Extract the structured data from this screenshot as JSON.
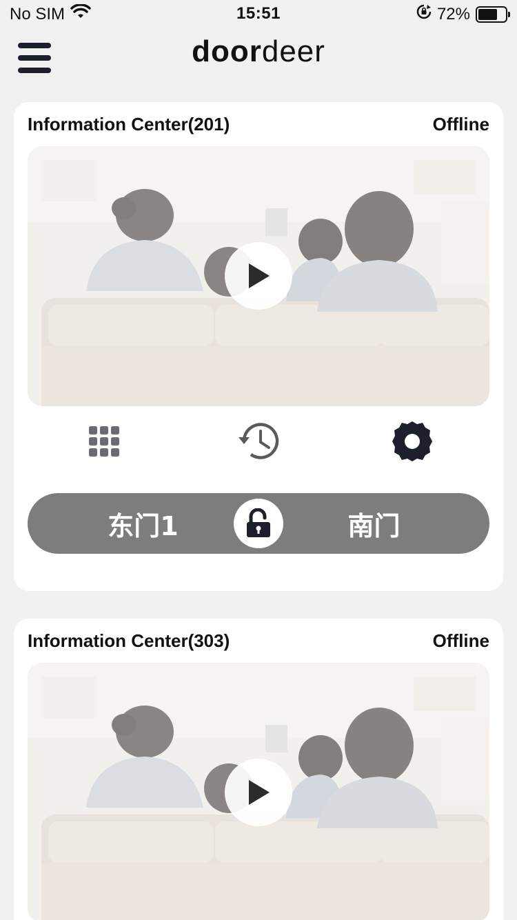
{
  "status_bar": {
    "carrier": "No SIM",
    "time": "15:51",
    "battery_text": "72%",
    "battery_level": 0.72,
    "icons": [
      "wifi-icon",
      "orientation-lock-icon",
      "battery-icon"
    ]
  },
  "nav": {
    "menu_icon": "hamburger-menu-icon",
    "logo_bold": "door",
    "logo_light": "deer"
  },
  "devices": [
    {
      "name": "Information Center(201)",
      "status": "Offline",
      "tools": [
        "keypad-icon",
        "history-icon",
        "gear-icon"
      ],
      "doors": {
        "left": "东门1",
        "right": "南门"
      }
    },
    {
      "name": "Information Center(303)",
      "status": "Offline"
    }
  ],
  "colors": {
    "background": "#f1f1f1",
    "card": "#ffffff",
    "unlock_bar": "#7d7d7d",
    "icon_dark": "#1d1f2c",
    "icon_gray": "#6b6b6b"
  }
}
